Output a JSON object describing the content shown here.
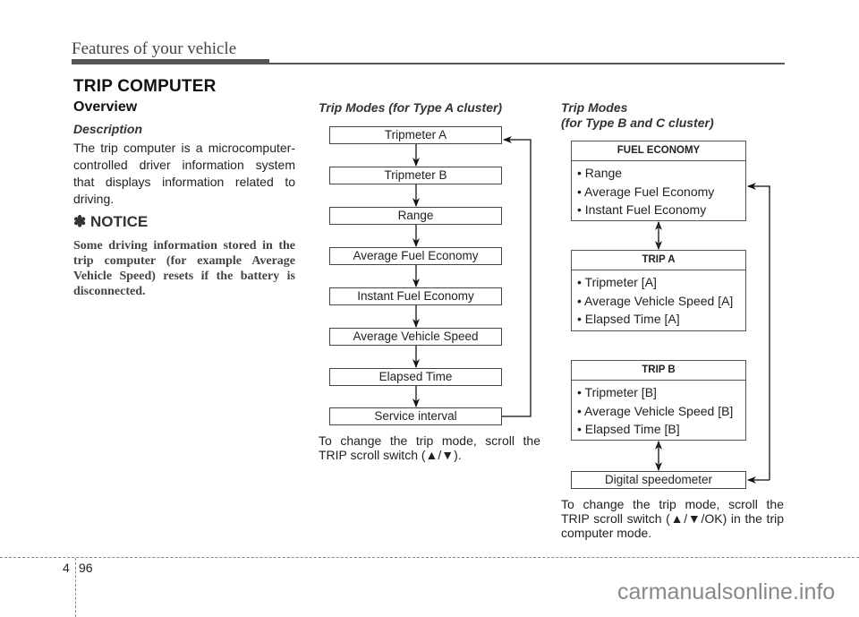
{
  "header": {
    "running_head": "Features of your vehicle"
  },
  "section": {
    "title": "TRIP COMPUTER",
    "overview_heading": "Overview",
    "description_heading": "Description",
    "description_text": "The trip computer is a microcomputer-controlled driver information system that displays information related to driving.",
    "notice_icon": "asterisk-icon",
    "notice_symbol": "✽",
    "notice_heading": "NOTICE",
    "notice_text": "Some driving information stored in the trip computer (for example Average Vehicle Speed) resets if the battery is disconnected."
  },
  "type_a": {
    "heading": "Trip Modes (for Type A cluster)",
    "modes": [
      "Tripmeter A",
      "Tripmeter B",
      "Range",
      "Average Fuel Economy",
      "Instant Fuel Economy",
      "Average Vehicle Speed",
      "Elapsed Time",
      "Service interval"
    ],
    "caption": "To change the trip mode, scroll the TRIP scroll switch (▲/▼)."
  },
  "type_bc": {
    "heading_line1": "Trip Modes",
    "heading_line2": "(for Type B and C cluster)",
    "groups": [
      {
        "title": "FUEL ECONOMY",
        "items": [
          "• Range",
          "• Average Fuel Economy",
          "• Instant Fuel Economy"
        ]
      },
      {
        "title": "TRIP A",
        "items": [
          "• Tripmeter [A]",
          "• Average Vehicle Speed [A]",
          "• Elapsed Time [A]"
        ]
      },
      {
        "title": "TRIP B",
        "items": [
          "• Tripmeter [B]",
          "• Average Vehicle Speed [B]",
          "• Elapsed Time [B]"
        ]
      }
    ],
    "speedometer_label": "Digital speedometer",
    "caption": "To change the trip mode, scroll the TRIP scroll switch (▲/▼/OK) in the trip computer mode."
  },
  "footer": {
    "chapter": "4",
    "page": "96",
    "watermark": "carmanualsonline.info"
  }
}
